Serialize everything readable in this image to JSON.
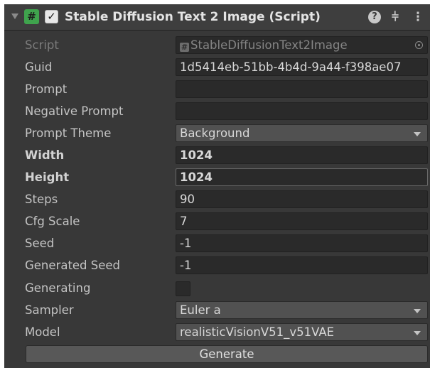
{
  "component": {
    "title": "Stable Diffusion Text 2 Image (Script)",
    "enabled": true,
    "icons": [
      "foldout-arrow-icon",
      "script-icon",
      "checkbox-icon",
      "help-icon",
      "presets-icon",
      "kebab-menu-icon"
    ]
  },
  "fields": {
    "script": {
      "label": "Script",
      "value": "StableDiffusionText2Image"
    },
    "guid": {
      "label": "Guid",
      "value": "1d5414eb-51bb-4b4d-9a44-f398ae07"
    },
    "prompt": {
      "label": "Prompt",
      "value": ""
    },
    "negative_prompt": {
      "label": "Negative Prompt",
      "value": ""
    },
    "prompt_theme": {
      "label": "Prompt Theme",
      "value": "Background"
    },
    "width": {
      "label": "Width",
      "value": "1024"
    },
    "height": {
      "label": "Height",
      "value": "1024"
    },
    "steps": {
      "label": "Steps",
      "value": "90"
    },
    "cfg_scale": {
      "label": "Cfg Scale",
      "value": "7"
    },
    "seed": {
      "label": "Seed",
      "value": "-1"
    },
    "generated_seed": {
      "label": "Generated Seed",
      "value": "-1"
    },
    "generating": {
      "label": "Generating",
      "checked": false
    },
    "sampler": {
      "label": "Sampler",
      "value": "Euler a"
    },
    "model": {
      "label": "Model",
      "value": "realisticVisionV51_v51VAE"
    }
  },
  "actions": {
    "generate_label": "Generate"
  },
  "colors": {
    "panel_bg": "#383838",
    "header_bg": "#3e3e3e",
    "field_bg": "#2a2a2a",
    "dropdown_bg": "#515151",
    "button_bg": "#585858",
    "script_icon": "#3fa34d"
  }
}
